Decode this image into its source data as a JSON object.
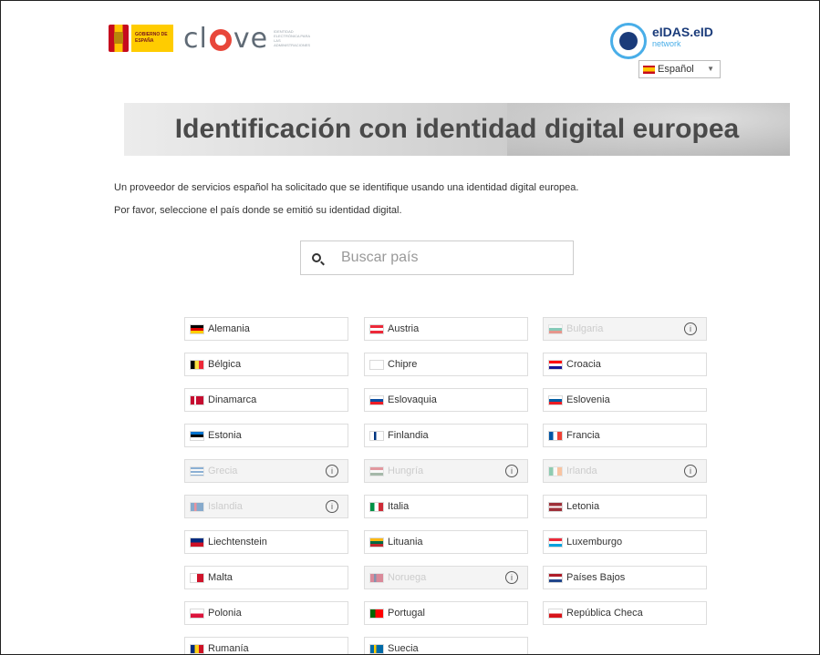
{
  "header": {
    "gov_logo_text": "GOBIERNO DE ESPAÑA",
    "clave_text": "cl ve",
    "clave_tagline": "IDENTIDAD ELECTRÓNICA PARA LAS ADMINISTRACIONES",
    "eidas_name": "eIDAS.eID",
    "eidas_sub": "network",
    "language_selected": "Español"
  },
  "banner": {
    "title": "Identificación con identidad digital europea"
  },
  "intro": {
    "line1": "Un proveedor de servicios español ha solicitado que se identifique usando una identidad digital europea.",
    "line2": "Por favor, seleccione el país donde se emitió su identidad digital."
  },
  "search": {
    "placeholder": "Buscar país"
  },
  "countries": [
    {
      "name": "Alemania",
      "enabled": true
    },
    {
      "name": "Austria",
      "enabled": true
    },
    {
      "name": "Bulgaria",
      "enabled": false
    },
    {
      "name": "Bélgica",
      "enabled": true
    },
    {
      "name": "Chipre",
      "enabled": true
    },
    {
      "name": "Croacia",
      "enabled": true
    },
    {
      "name": "Dinamarca",
      "enabled": true
    },
    {
      "name": "Eslovaquia",
      "enabled": true
    },
    {
      "name": "Eslovenia",
      "enabled": true
    },
    {
      "name": "Estonia",
      "enabled": true
    },
    {
      "name": "Finlandia",
      "enabled": true
    },
    {
      "name": "Francia",
      "enabled": true
    },
    {
      "name": "Grecia",
      "enabled": false
    },
    {
      "name": "Hungría",
      "enabled": false
    },
    {
      "name": "Irlanda",
      "enabled": false
    },
    {
      "name": "Islandia",
      "enabled": false
    },
    {
      "name": "Italia",
      "enabled": true
    },
    {
      "name": "Letonia",
      "enabled": true
    },
    {
      "name": "Liechtenstein",
      "enabled": true
    },
    {
      "name": "Lituania",
      "enabled": true
    },
    {
      "name": "Luxemburgo",
      "enabled": true
    },
    {
      "name": "Malta",
      "enabled": true
    },
    {
      "name": "Noruega",
      "enabled": false
    },
    {
      "name": "Países Bajos",
      "enabled": true
    },
    {
      "name": "Polonia",
      "enabled": true
    },
    {
      "name": "Portugal",
      "enabled": true
    },
    {
      "name": "República Checa",
      "enabled": true
    },
    {
      "name": "Rumanía",
      "enabled": true
    },
    {
      "name": "Suecia",
      "enabled": true
    }
  ],
  "info_symbol": "i"
}
